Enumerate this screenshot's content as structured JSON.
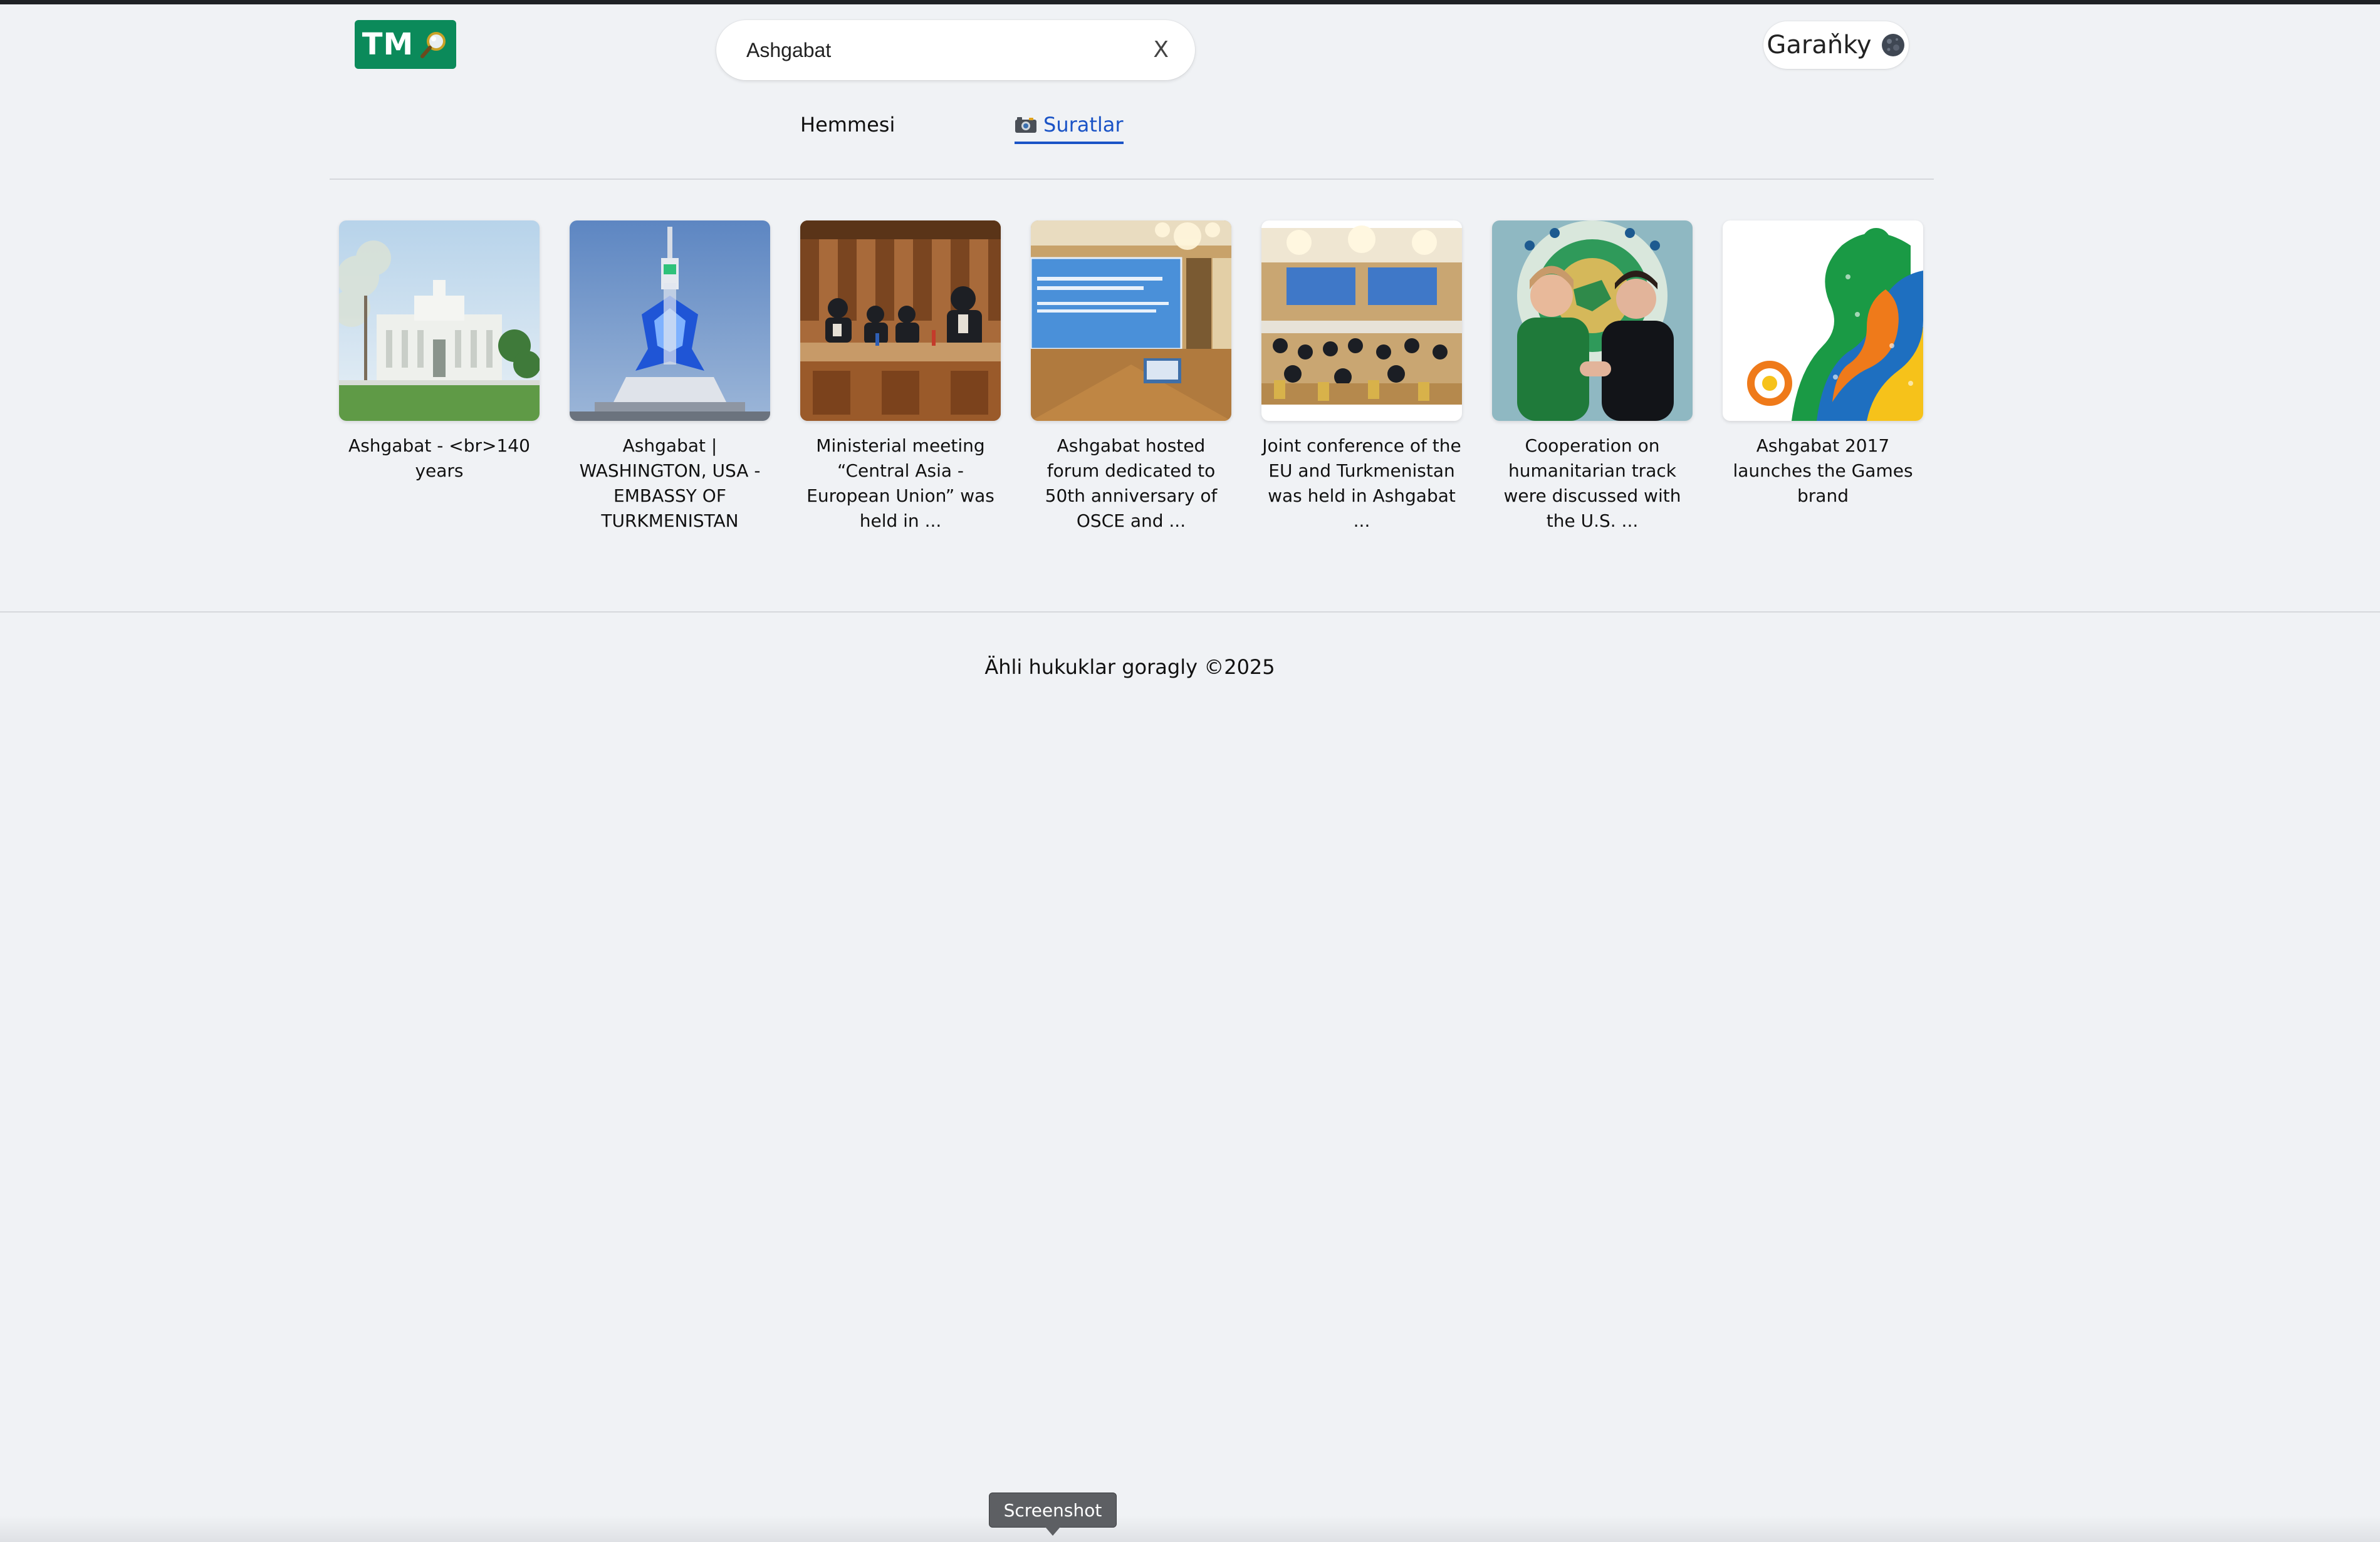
{
  "header": {
    "logo_text": "TM",
    "logo_icon": "magnifier-icon",
    "search": {
      "value": "Ashgabat",
      "clear_label": "X"
    },
    "theme_toggle": {
      "label": "Garaňky",
      "icon": "moon-icon"
    }
  },
  "tabs": [
    {
      "label": "Hemmesi",
      "active": false
    },
    {
      "label": "Suratlar",
      "active": true,
      "icon": "camera-icon"
    }
  ],
  "colors": {
    "brand_green": "#0b8a5a",
    "active_tab_blue": "#1a53c6",
    "page_background": "#f0f2f5"
  },
  "results": [
    {
      "caption": "Ashgabat - <br>140 years",
      "thumbnail": "white-palace-with-trees-image"
    },
    {
      "caption": "Ashgabat | WASHINGTON, USA - EMBASSY OF TURKMENISTAN",
      "thumbnail": "blue-tv-tower-image"
    },
    {
      "caption": "Ministerial meeting “Central Asia - European Union” was held in ...",
      "thumbnail": "meeting-table-image"
    },
    {
      "caption": "Ashgabat hosted forum dedicated to 50th anniversary of OSCE and ...",
      "thumbnail": "forum-hall-screen-image"
    },
    {
      "caption": "Joint conference of the EU and Turkmenistan was held in Ashgabat ...",
      "thumbnail": "conference-hall-image"
    },
    {
      "caption": "Cooperation on humanitarian track were discussed with the U.S. ...",
      "thumbnail": "two-women-handshake-image"
    },
    {
      "caption": "Ashgabat 2017 launches the Games brand",
      "thumbnail": "games-brand-pattern-image"
    }
  ],
  "footer": {
    "copyright": "Ähli hukuklar goragly ©2025"
  },
  "tooltip": {
    "label": "Screenshot"
  }
}
